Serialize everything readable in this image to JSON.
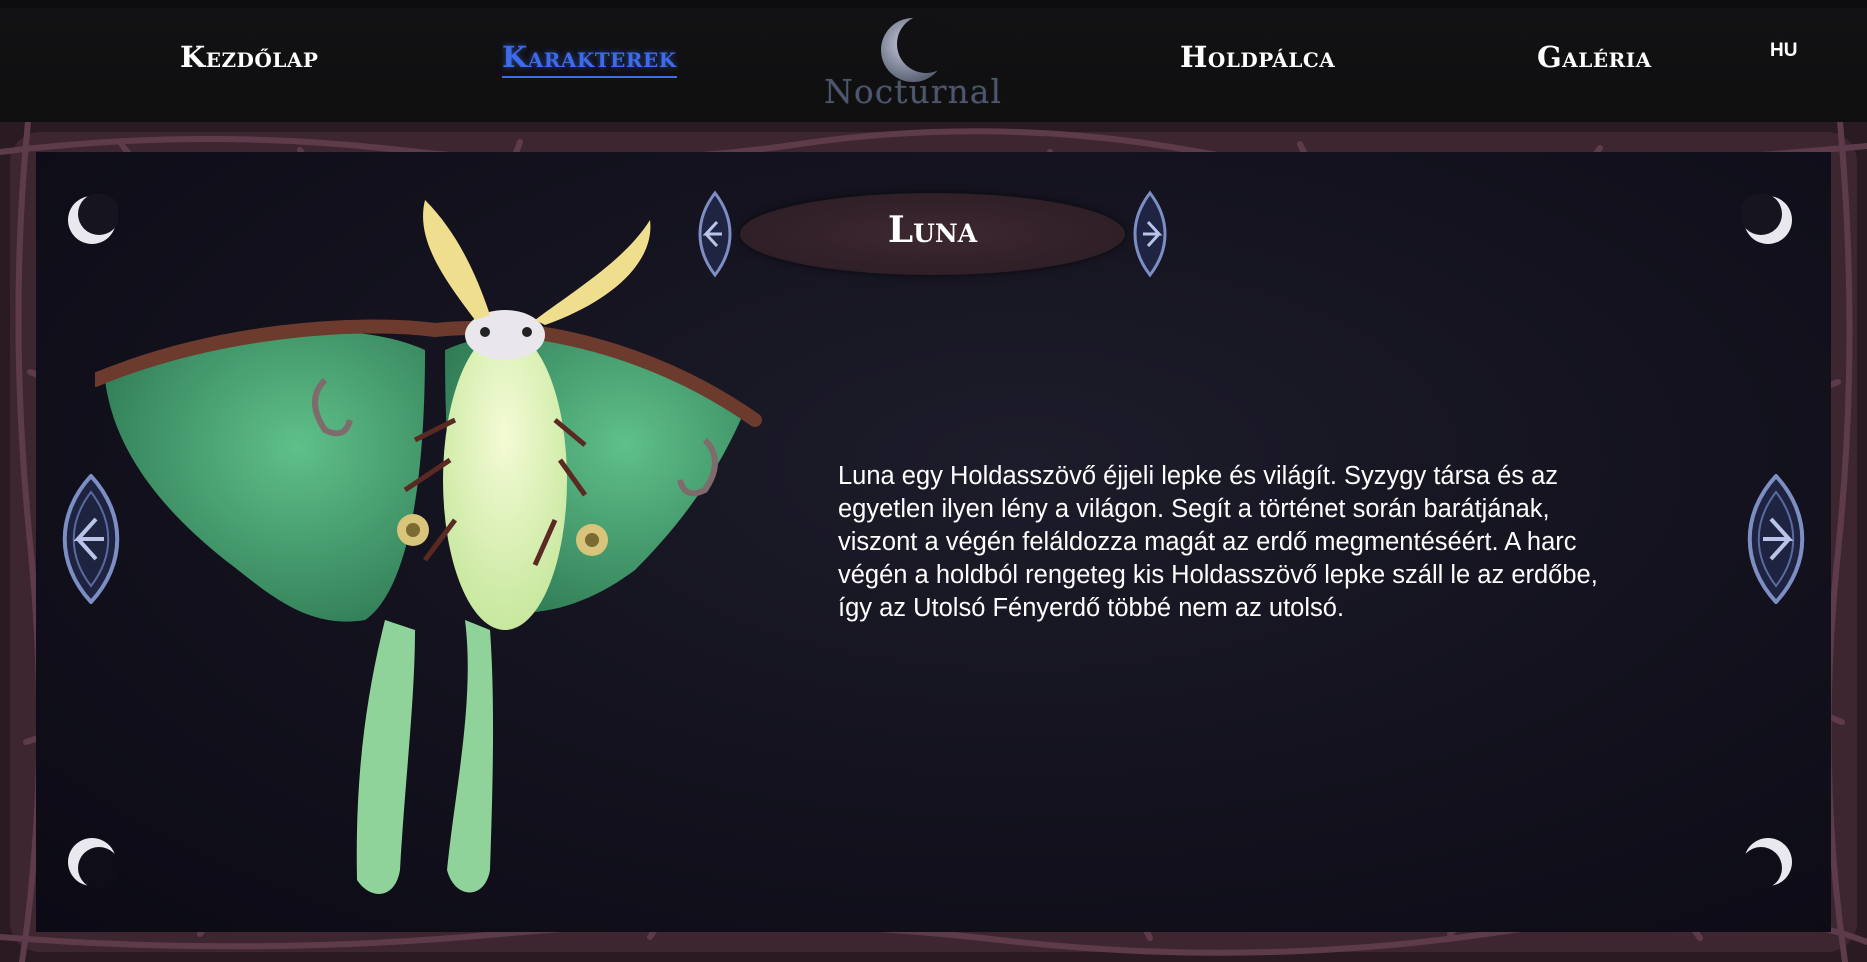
{
  "nav": {
    "items": [
      {
        "label": "Kezdőlap",
        "active": false
      },
      {
        "label": "Karakterek",
        "active": true
      },
      {
        "label": "Holdpálca",
        "active": false
      },
      {
        "label": "Galéria",
        "active": false
      }
    ],
    "logo_text": "Nocturnal",
    "language": "HU"
  },
  "character": {
    "name": "Luna",
    "description": "Luna egy Holdasszövő éjjeli lepke és világít. Syzygy társa és az egyetlen ilyen lény a világon. Segít a történet során barátjának, viszont a végén feláldozza magát az erdő megmentéséért. A harc végén a holdból rengeteg kis Holdasszövő lepke száll le az erdőbe, így az Utolsó Fényerdő többé nem az utolsó."
  },
  "colors": {
    "accent_active": "#3e6bea",
    "background": "#0b0a14",
    "frame": "#5a3a48",
    "title_pill": "#3d2830"
  },
  "icons": {
    "prev_small": "chevron-left-icon",
    "next_small": "chevron-right-icon",
    "prev_large": "arrow-left-icon",
    "next_large": "arrow-right-icon",
    "corner": "crescent-moon-icon"
  }
}
